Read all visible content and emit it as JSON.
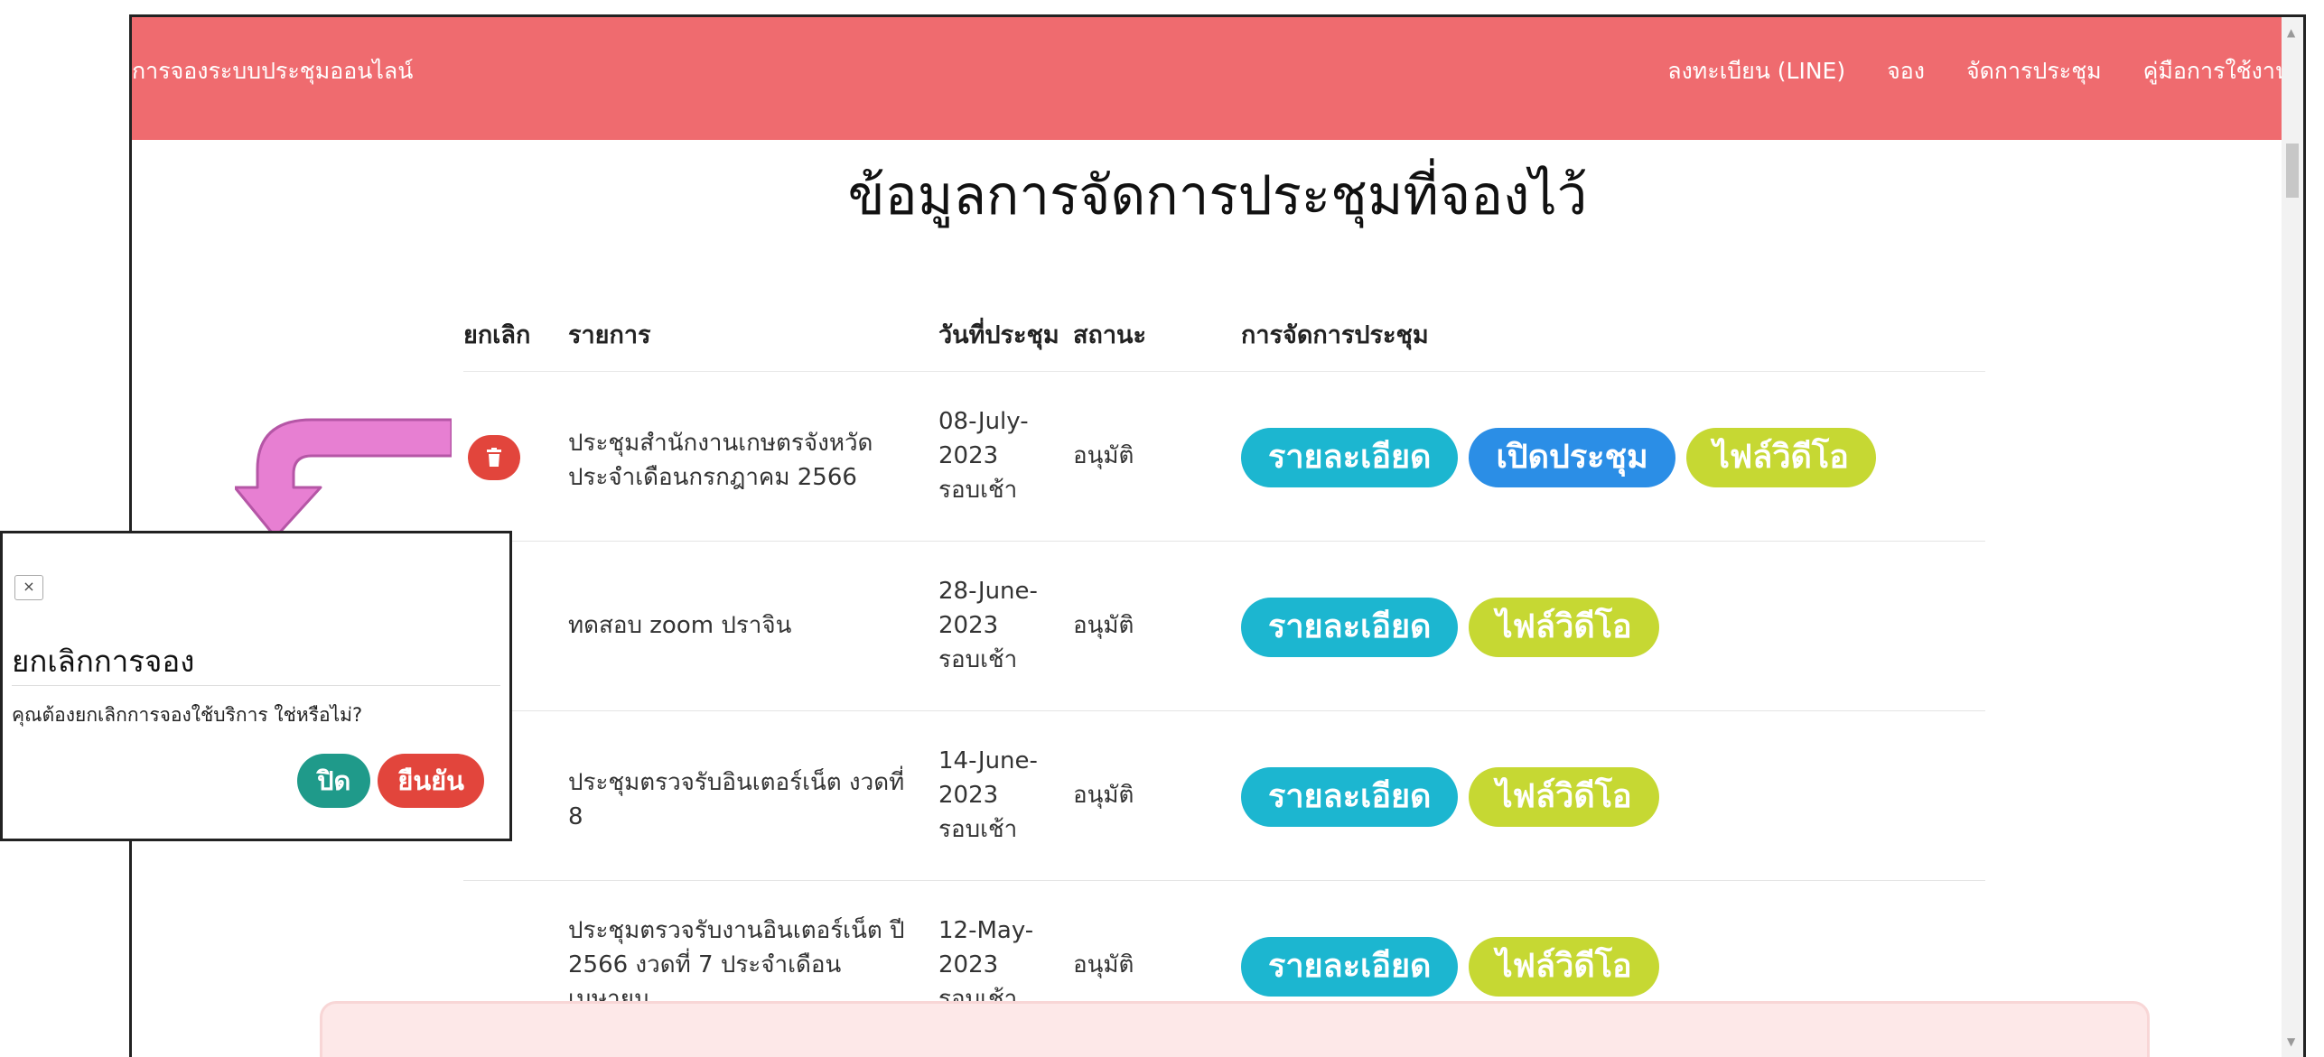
{
  "navbar": {
    "brand": "การจองระบบประชุมออนไลน์",
    "links": [
      "ลงทะเบียน (LINE)",
      "จอง",
      "จัดการประชุม",
      "คู่มือการใช้งาน"
    ]
  },
  "page": {
    "title": "ข้อมูลการจัดการประชุมที่จองไว้"
  },
  "table": {
    "headers": [
      "ยกเลิก",
      "รายการ",
      "วันที่ประชุม",
      "สถานะ",
      "การจัดการประชุม"
    ],
    "rows": [
      {
        "item": "ประชุมสำนักงานเกษตรจังหวัด ประจำเดือนกรกฎาคม 2566",
        "date_line1": "08-July-",
        "date_line2": "2023",
        "date_line3": "รอบเช้า",
        "status": "อนุมัติ",
        "actions": [
          "รายละเอียด",
          "เปิดประชุม",
          "ไฟล์วิดีโอ"
        ],
        "has_delete": true
      },
      {
        "item": "ทดสอบ zoom ปราจิน",
        "date_line1": "28-June-",
        "date_line2": "2023",
        "date_line3": "รอบเช้า",
        "status": "อนุมัติ",
        "actions": [
          "รายละเอียด",
          "ไฟล์วิดีโอ"
        ],
        "has_delete": false
      },
      {
        "item": "ประชุมตรวจรับอินเตอร์เน็ต งวดที่ 8",
        "date_line1": "14-June-",
        "date_line2": "2023",
        "date_line3": "รอบเช้า",
        "status": "อนุมัติ",
        "actions": [
          "รายละเอียด",
          "ไฟล์วิดีโอ"
        ],
        "has_delete": false
      },
      {
        "item": "ประชุมตรวจรับงานอินเตอร์เน็ต ปี 2566 งวดที่ 7 ประจำเดือน เมษายน",
        "date_line1": "12-May-",
        "date_line2": "2023",
        "date_line3": "รอบเช้า",
        "status": "อนุมัติ",
        "actions": [
          "รายละเอียด",
          "ไฟล์วิดีโอ"
        ],
        "has_delete": false
      }
    ]
  },
  "modal": {
    "close_symbol": "×",
    "title": "ยกเลิกการจอง",
    "body": "คุณต้องยกเลิกการจองใช้บริการ ใช่หรือไม่?",
    "close_label": "ปิด",
    "confirm_label": "ยืนยัน"
  },
  "colors": {
    "navbar": "#ef6b6f",
    "info": "#1cb6d0",
    "primary": "#2b8ee6",
    "video": "#c6d833",
    "danger": "#e2453c",
    "teal": "#1f9a8a",
    "arrow": "#e77fd2"
  },
  "icons": {
    "delete": "trash-icon",
    "pointer": "curved-arrow-icon"
  }
}
